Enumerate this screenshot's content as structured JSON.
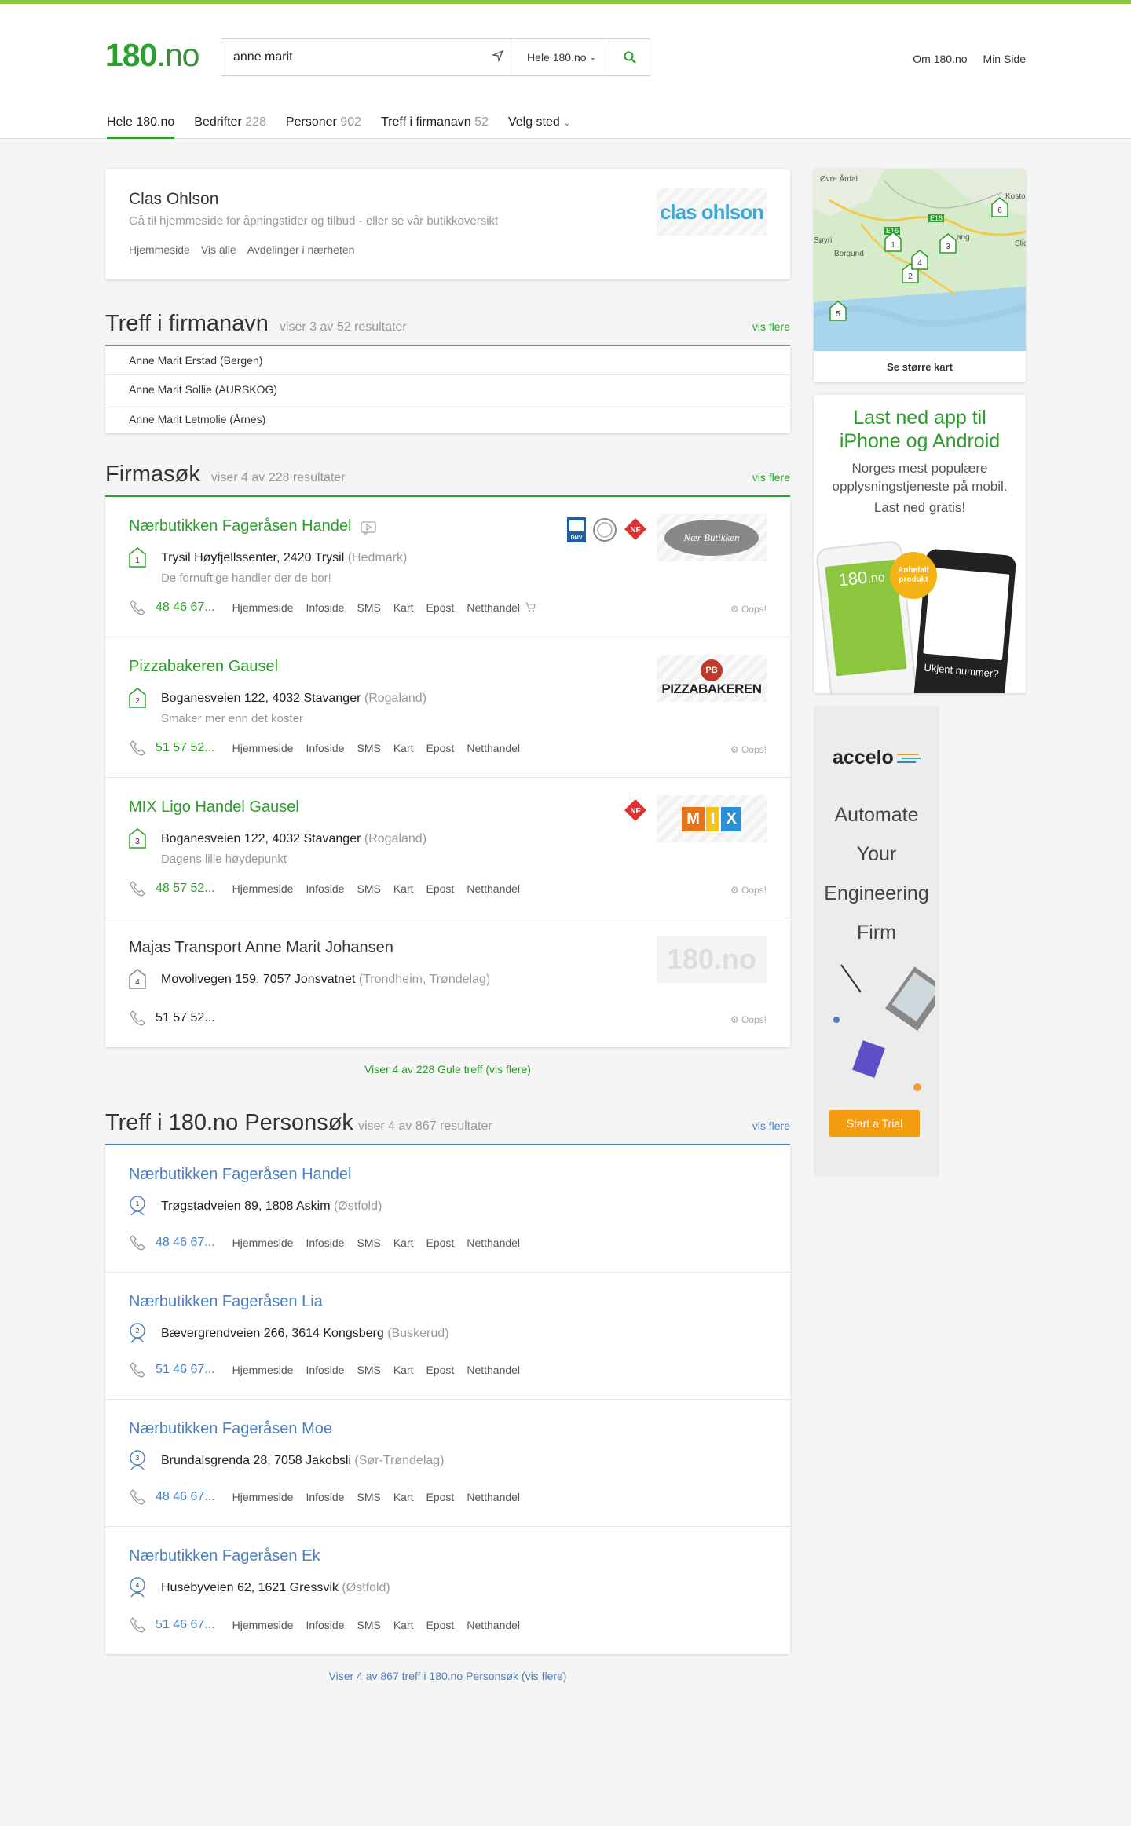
{
  "header": {
    "logo_main": "180",
    "logo_suffix": ".no",
    "search_value": "anne marit",
    "scope_label": "Hele 180.no",
    "links": [
      "Om 180.no",
      "Min Side"
    ]
  },
  "tabs": [
    {
      "label": "Hele 180.no",
      "count": ""
    },
    {
      "label": "Bedrifter",
      "count": "228"
    },
    {
      "label": "Personer",
      "count": "902"
    },
    {
      "label": "Treff i firmanavn",
      "count": "52"
    },
    {
      "label": "Velg sted",
      "count": ""
    }
  ],
  "promo": {
    "title": "Clas Ohlson",
    "subtitle": "Gå til hjemmeside for åpningstider og tilbud - eller se vår butikkoversikt",
    "links": [
      "Hjemmeside",
      "Vis alle",
      "Avdelinger i nærheten"
    ],
    "brand": "clas ohlson"
  },
  "names_section": {
    "title": "Treff i firmanavn",
    "meta": "viser 3 av 52 resultater",
    "more": "vis flere",
    "rows": [
      "Anne Marit Erstad (Bergen)",
      "Anne Marit Sollie (AURSKOG)",
      "Anne Marit Letmolie (Årnes)"
    ]
  },
  "company_section": {
    "title": "Firmasøk",
    "meta": "viser 4 av 228 resultater",
    "more": "vis flere",
    "footer": "Viser 4 av 228 Gule treff (vis flere)",
    "results": [
      {
        "n": "1",
        "name": "Nærbutikken Fageråsen Handel",
        "addr": "Trysil Høyfjellssenter, 2420 Trysil",
        "region": "(Hedmark)",
        "slogan": "De fornuftige handler der de bor!",
        "phone": "48 46 67...",
        "actions": [
          "Hjemmeside",
          "Infoside",
          "SMS",
          "Kart",
          "Epost",
          "Netthandel"
        ],
        "oops": "Oops!",
        "logo": "Nær Butikken"
      },
      {
        "n": "2",
        "name": "Pizzabakeren Gausel",
        "addr": "Boganesveien 122, 4032 Stavanger",
        "region": "(Rogaland)",
        "slogan": "Smaker mer enn det koster",
        "phone": "51 57 52...",
        "actions": [
          "Hjemmeside",
          "Infoside",
          "SMS",
          "Kart",
          "Epost",
          "Netthandel"
        ],
        "oops": "Oops!",
        "logo": "PIZZABAKEREN"
      },
      {
        "n": "3",
        "name": "MIX Ligo Handel Gausel",
        "addr": "Boganesveien 122, 4032 Stavanger",
        "region": "(Rogaland)",
        "slogan": "Dagens lille høydepunkt",
        "phone": "48 57 52...",
        "actions": [
          "Hjemmeside",
          "Infoside",
          "SMS",
          "Kart",
          "Epost",
          "Netthandel"
        ],
        "oops": "Oops!",
        "logo": "MIX"
      },
      {
        "n": "4",
        "name": "Majas Transport Anne Marit Johansen",
        "addr": "Movollvegen 159, 7057 Jonsvatnet",
        "region": "(Trondheim, Trøndelag)",
        "slogan": "",
        "phone": "51 57 52...",
        "actions": [],
        "oops": "Oops!",
        "logo": "180.no"
      }
    ]
  },
  "person_section": {
    "title": "Treff i 180.no Personsøk",
    "meta": "viser 4 av 867 resultater",
    "more": "vis flere",
    "footer": "Viser 4 av 867 treff i 180.no Personsøk (vis flere)",
    "results": [
      {
        "n": "1",
        "name": "Nærbutikken Fageråsen Handel",
        "addr": "Trøgstadveien 89, 1808 Askim",
        "region": "(Østfold)",
        "phone": "48 46 67...",
        "actions": [
          "Hjemmeside",
          "Infoside",
          "SMS",
          "Kart",
          "Epost",
          "Netthandel"
        ]
      },
      {
        "n": "2",
        "name": "Nærbutikken Fageråsen Lia",
        "addr": "Bævergrendveien 266, 3614 Kongsberg",
        "region": "(Buskerud)",
        "phone": "51 46 67...",
        "actions": [
          "Hjemmeside",
          "Infoside",
          "SMS",
          "Kart",
          "Epost",
          "Netthandel"
        ]
      },
      {
        "n": "3",
        "name": "Nærbutikken Fageråsen Moe",
        "addr": "Brundalsgrenda 28, 7058 Jakobsli",
        "region": "(Sør-Trøndelag)",
        "phone": "48 46 67...",
        "actions": [
          "Hjemmeside",
          "Infoside",
          "SMS",
          "Kart",
          "Epost",
          "Netthandel"
        ]
      },
      {
        "n": "4",
        "name": "Nærbutikken Fageråsen Ek",
        "addr": "Husebyveien 62, 1621 Gressvik",
        "region": "(Østfold)",
        "phone": "51 46 67...",
        "actions": [
          "Hjemmeside",
          "Infoside",
          "SMS",
          "Kart",
          "Epost",
          "Netthandel"
        ]
      }
    ]
  },
  "sidebar": {
    "map_caption": "Se større kart",
    "map_labels": [
      "Øvre Årdal",
      "Borgund",
      "E16",
      "E18",
      "Søyri",
      "Slid",
      "Kostol",
      "ang"
    ],
    "map_pins": [
      "1",
      "2",
      "3",
      "4",
      "5",
      "6"
    ],
    "app_title": "Last ned app til iPhone og Android",
    "app_text": "Norges mest populære opplysningstjeneste på mobil.",
    "app_cta": "Last ned gratis!",
    "app_badge": "Anbefalt produkt",
    "app_unknown": "Ukjent nummer?",
    "ad_brand": "accelo",
    "ad_lines": [
      "Automate",
      "Your",
      "Engineering",
      "Firm"
    ],
    "ad_cta": "Start a Trial"
  },
  "colors": {
    "green": "#2a9d2a",
    "blue": "#4a7fc1",
    "topbar": "#8cc63f",
    "orange": "#f39c12"
  }
}
